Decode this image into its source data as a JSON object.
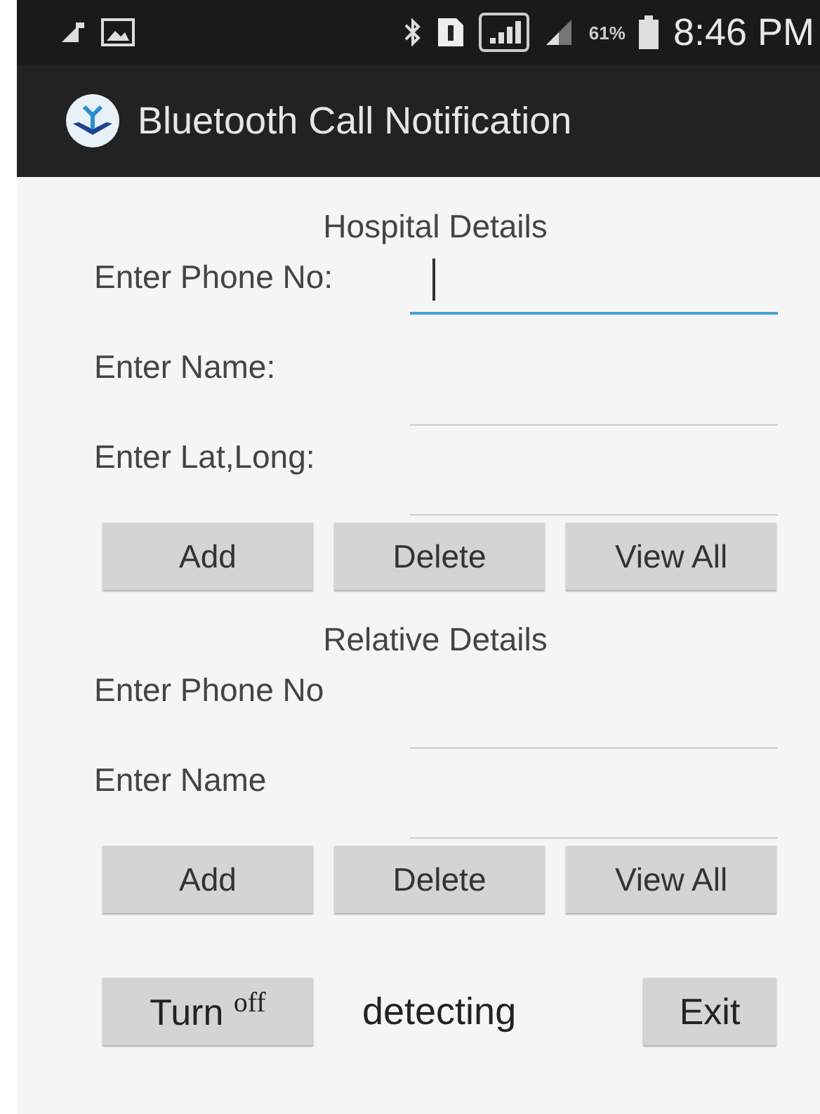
{
  "status_bar": {
    "battery": "61%",
    "time": "8:46 PM"
  },
  "app_bar": {
    "title": "Bluetooth Call Notification"
  },
  "sections": [
    {
      "title": "Hospital Details",
      "fields": [
        {
          "label": "Enter Phone No:",
          "focused": true
        },
        {
          "label": "Enter Name:",
          "focused": false
        },
        {
          "label": "Enter Lat,Long:",
          "focused": false
        }
      ],
      "buttons": [
        "Add",
        "Delete",
        "View All"
      ]
    },
    {
      "title": "Relative Details",
      "fields": [
        {
          "label": "Enter Phone No",
          "focused": false
        },
        {
          "label": "Enter Name",
          "focused": false
        }
      ],
      "buttons": [
        "Add",
        "Delete",
        "View All"
      ]
    }
  ],
  "footer": {
    "toggle_button": "Turn $^{off}$",
    "status": "detecting",
    "exit_button": "Exit"
  }
}
